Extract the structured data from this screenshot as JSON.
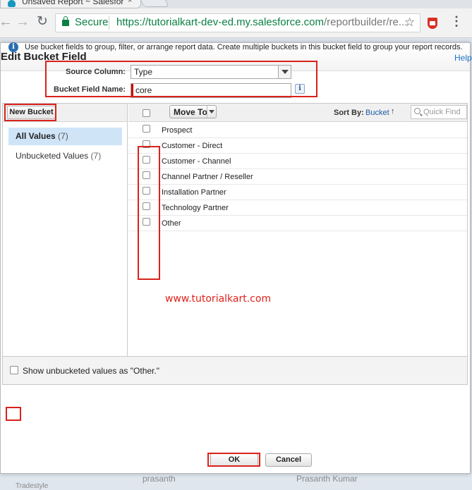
{
  "browser": {
    "tab_title": "Unsaved Report ~ Salesfor",
    "tab_close": "×",
    "secure_label": "Secure",
    "url_base": "https://tutorialkart-dev-ed.my.salesforce.com",
    "url_rest": "/reportbuilder/re...",
    "icons": {
      "back": "←",
      "forward": "→",
      "reload": "↻",
      "star": "☆",
      "menu": "⋮"
    }
  },
  "background": {
    "row_text_1": "prasanth",
    "row_text_2": "Prasanth Kumar",
    "row_text_3": "Tradestyle"
  },
  "dialog": {
    "title": "Edit Bucket Field",
    "help": "Help",
    "info_icon": "i",
    "info_text": "Use bucket fields to group, filter, or arrange report data. Create multiple buckets in this bucket field to group your report records."
  },
  "form": {
    "source_label": "Source Column:",
    "source_value": "Type",
    "bucket_name_label": "Bucket Field Name:",
    "bucket_name_value": "core",
    "info_icon": "i"
  },
  "left_pane": {
    "new_bucket_label": "New Bucket",
    "all_values_label": "All Values",
    "all_values_count": "(7)",
    "unbucketed_label": "Unbucketed Values",
    "unbucketed_count": "(7)"
  },
  "right_pane": {
    "move_to_label": "Move To",
    "sort_by_label": "Sort By:",
    "sort_by_value": "Bucket",
    "sort_arrow": "↑",
    "quick_find_placeholder": "Quick Find",
    "values": [
      "Prospect",
      "Customer - Direct",
      "Customer - Channel",
      "Channel Partner / Reseller",
      "Installation Partner",
      "Technology Partner",
      "Other"
    ]
  },
  "watermark": "www.tutorialkart.com",
  "footer": {
    "show_other_label": "Show unbucketed values as \"Other.\"",
    "ok_label": "OK",
    "cancel_label": "Cancel"
  },
  "colors": {
    "highlight_red": "#d9221c",
    "secure_green": "#0b8043",
    "selected_bucket_bg": "#cfe4f7",
    "link_blue": "#1c73c5"
  }
}
